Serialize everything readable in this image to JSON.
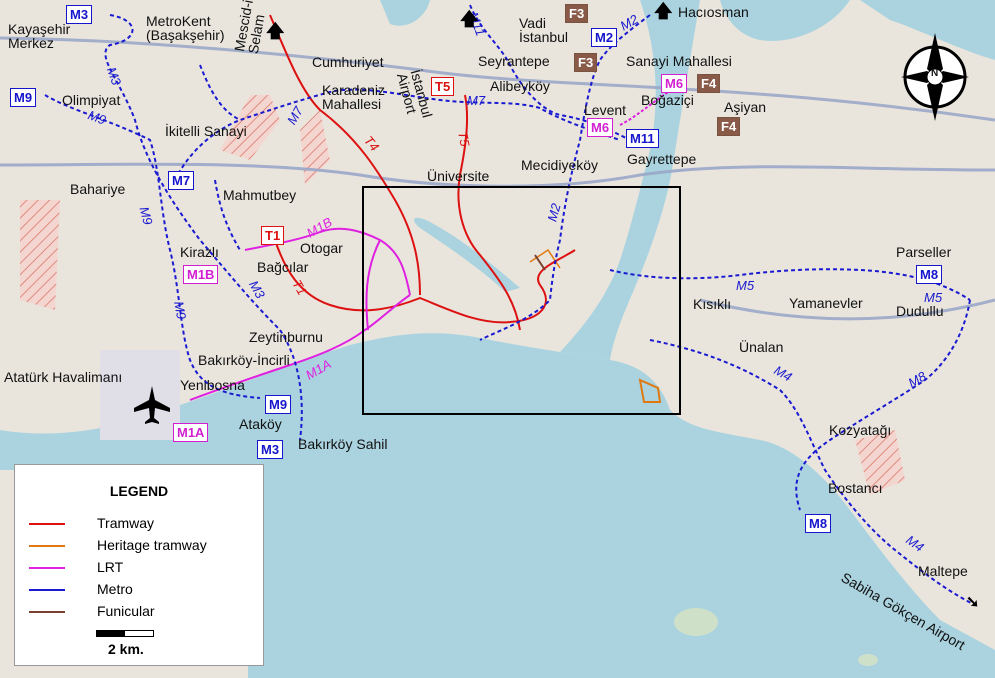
{
  "map_labels": {
    "kayasehir": "Kayaşehir\nMerkez",
    "metrokent": "MetroKent\n(Başakşehir)",
    "mescidi_selam": "Mescid-i\nSelam",
    "istanbul_airport": "İstanbul\nAirport",
    "vadi_istanbul": "Vadi\nİstanbul",
    "haciosman": "Hacıosman",
    "cumhuriyet": "Cumhuriyet",
    "seyrantepe": "Seyrantepe",
    "sanayi_mahallesi": "Sanayi Mahallesi",
    "olimpiyat": "Olimpiyat",
    "karadeniz": "Karadeniz\nMahallesi",
    "alibeykoy": "Alibeyköy",
    "bogazici": "Boğaziçi",
    "asiyan": "Aşiyan",
    "levent": "Levent",
    "ikitelli": "İkitelli Sanayi",
    "gayrettepe": "Gayrettepe",
    "universite": "Üniversite",
    "mecidiyekoy": "Mecidiyeköy",
    "bahariye": "Bahariye",
    "mahmutbey": "Mahmutbey",
    "kirazli": "Kirazlı",
    "otogar": "Otogar",
    "bagcilar": "Bağcılar",
    "parseller": "Parseller",
    "kisikli": "Kısıklı",
    "yamanevler": "Yamanevler",
    "dudullu": "Dudullu",
    "zeytinburnu": "Zeytinburnu",
    "unalan": "Ünalan",
    "bakirkoy_incirli": "Bakırköy-İncirli",
    "ataturk_havalimani": "Atatürk Havalimanı",
    "yenibosna": "Yenibosna",
    "atakoy": "Ataköy",
    "bakirkoy_sahil": "Bakırköy Sahil",
    "kozyatagi": "Kozyatağı",
    "bostanci": "Bostancı",
    "maltepe": "Maltepe",
    "sabiha": "Sabiha Gökçen Airport"
  },
  "badges": {
    "m3_top": "M3",
    "m9_left": "M9",
    "m7_left": "M7",
    "t5": "T5",
    "m7_t": "M7",
    "f3_top": "F3",
    "m2_top": "M2",
    "f3_b": "F3",
    "m6_top": "M6",
    "f4_top": "F4",
    "m6_lev": "M6",
    "m11": "M11",
    "f4_b": "F4",
    "t1": "T1",
    "m1b_otogar": "M1B",
    "m1b_left": "M1B",
    "m8_right": "M8",
    "m9_bottom": "M9",
    "m1a": "M1A",
    "m3_bottom": "M3",
    "m8_bottom": "M8"
  },
  "line_tags": {
    "m11": "M11",
    "m2": "M2",
    "m3": "M3",
    "m9": "M9",
    "m7": "M7",
    "t4": "T4",
    "t5": "T5",
    "m1b": "M1B",
    "t1": "T1",
    "m1a": "M1A",
    "m5": "M5",
    "m4": "M4",
    "m8": "M8",
    "m5b": "M5",
    "m4b": "M4",
    "m2b": "M2",
    "m3b": "M3",
    "m9b": "M9",
    "m7b": "M7"
  },
  "legend": {
    "title": "LEGEND",
    "items": [
      {
        "label": "Tramway",
        "color": "#dd1111"
      },
      {
        "label": "Heritage tramway",
        "color": "#e07a10"
      },
      {
        "label": "LRT",
        "color": "#e020e0"
      },
      {
        "label": "Metro",
        "color": "#1a1ad0"
      },
      {
        "label": "Funicular",
        "color": "#7a4030"
      }
    ],
    "scale_label": "2 km."
  },
  "arrow_glyph": "🡅",
  "compass_letter": "N",
  "colors": {
    "sea": "#aad3df",
    "land": "#e8e4dc",
    "tram": "#dd1111",
    "lrt": "#e020e0",
    "metro": "#1a1ad0",
    "funicular": "#7a4030",
    "heritage": "#e07a10"
  }
}
